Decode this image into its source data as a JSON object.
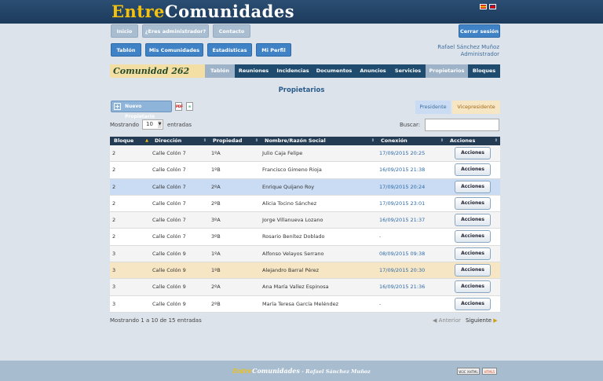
{
  "brand": {
    "part1": "Entre",
    "part2": "Comunidades"
  },
  "top_nav": [
    "Inicio",
    "¿Eres administrador?",
    "Contacto"
  ],
  "logout_label": "Cerrar sesión",
  "user_nav": [
    "Tablón",
    "Mis Comunidades",
    "Estadísticas",
    "Mi Perfil"
  ],
  "user": {
    "name": "Rafael Sánchez Muñoz",
    "role": "Administrador"
  },
  "community": {
    "title": "Comunidad 262",
    "tabs": [
      "Tablón",
      "Reuniones",
      "Incidencias",
      "Documentos",
      "Anuncios",
      "Servicios",
      "Propietarios",
      "Bloques"
    ],
    "active_tab": "Propietarios"
  },
  "page_title": "Propietarios",
  "new_owner_label": "Nuevo Propietario",
  "legend": {
    "president": "Presidente",
    "vicepresident": "Vicepresidente"
  },
  "colors": {
    "president": "#c9dcf3",
    "vicepresident": "#f7e6c4",
    "header": "#233c54",
    "accent": "#3f82c6"
  },
  "table_controls": {
    "show_label": "Mostrando",
    "entries_value": "10",
    "entries_label": "entradas",
    "search_label": "Buscar:"
  },
  "table": {
    "columns": [
      "Bloque",
      "Dirección",
      "Propiedad",
      "Nombre/Razón Social",
      "Conexión",
      "Acciones"
    ],
    "actions_label": "Acciones",
    "rows": [
      {
        "bloque": "2",
        "direccion": "Calle Colón 7",
        "propiedad": "1ºA",
        "nombre": "Julio Caja Felipe",
        "conexion": "17/09/2015 20:25"
      },
      {
        "bloque": "2",
        "direccion": "Calle Colón 7",
        "propiedad": "1ºB",
        "nombre": "Francisco Gimeno Rioja",
        "conexion": "16/09/2015 21:38"
      },
      {
        "bloque": "2",
        "direccion": "Calle Colón 7",
        "propiedad": "2ºA",
        "nombre": "Enrique Quijano Roy",
        "conexion": "17/09/2015 20:24"
      },
      {
        "bloque": "2",
        "direccion": "Calle Colón 7",
        "propiedad": "2ºB",
        "nombre": "Alicia Tocino Sánchez",
        "conexion": "17/09/2015 23:01"
      },
      {
        "bloque": "2",
        "direccion": "Calle Colón 7",
        "propiedad": "3ºA",
        "nombre": "Jorge Villanueva Lozano",
        "conexion": "16/09/2015 21:37"
      },
      {
        "bloque": "2",
        "direccion": "Calle Colón 7",
        "propiedad": "3ºB",
        "nombre": "Rosario Benítez Doblado",
        "conexion": "-"
      },
      {
        "bloque": "3",
        "direccion": "Calle Colón 9",
        "propiedad": "1ºA",
        "nombre": "Alfonso Velayos Serrano",
        "conexion": "08/09/2015 09:38"
      },
      {
        "bloque": "3",
        "direccion": "Calle Colón 9",
        "propiedad": "1ºB",
        "nombre": "Alejandro Barral Pérez",
        "conexion": "17/09/2015 20:30"
      },
      {
        "bloque": "3",
        "direccion": "Calle Colón 9",
        "propiedad": "2ºA",
        "nombre": "Ana María Vallez Espinosa",
        "conexion": "16/09/2015 21:36"
      },
      {
        "bloque": "3",
        "direccion": "Calle Colón 9",
        "propiedad": "2ºB",
        "nombre": "María Teresa García Meléndez",
        "conexion": "-"
      }
    ]
  },
  "footer_info": "Mostrando 1 a 10 de 15 entradas",
  "pager": {
    "prev": "Anterior",
    "next": "Siguiente"
  },
  "footer": {
    "brand1": "Entre",
    "brand2": "Comunidades",
    "author": " - Rafael Sánchez Muñoz"
  },
  "badges": [
    "W3C XHTML",
    "HTML5"
  ]
}
